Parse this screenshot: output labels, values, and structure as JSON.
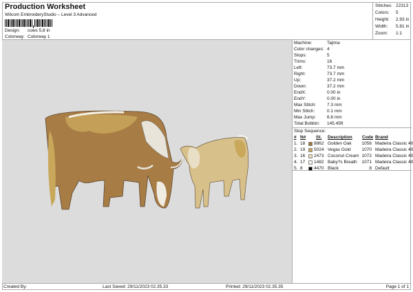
{
  "header": {
    "title": "Production Worksheet",
    "subtitle": "Wilcom EmbroideryStudio – Level 3 Advanced",
    "design_label": "Design:",
    "design_value": "cows 5,8 in",
    "colorway_label": "Colorway:",
    "colorway_value": "Colorway 1"
  },
  "stats": [
    {
      "label": "Stitches:",
      "value": "22313"
    },
    {
      "label": "Colors:",
      "value": "5"
    },
    {
      "label": "Height:",
      "value": "2.93 in"
    },
    {
      "label": "Width:",
      "value": "5.81 in"
    },
    {
      "label": "Zoom:",
      "value": "1:1"
    }
  ],
  "details": [
    {
      "label": "Machine:",
      "value": "Tajima"
    },
    {
      "label": "Color changes:",
      "value": "4"
    },
    {
      "label": "Stops:",
      "value": "5"
    },
    {
      "label": "Trims:",
      "value": "16"
    },
    {
      "label": "Left:",
      "value": "73.7 mm"
    },
    {
      "label": "Right:",
      "value": "73.7 mm"
    },
    {
      "label": "Up:",
      "value": "37.2 mm"
    },
    {
      "label": "Down:",
      "value": "37.2 mm"
    },
    {
      "label": "EndX:",
      "value": "0.00 in"
    },
    {
      "label": "EndY:",
      "value": "0.00 in"
    },
    {
      "label": "Max Stitch:",
      "value": "7.3 mm"
    },
    {
      "label": "Min Stitch:",
      "value": "0.1 mm"
    },
    {
      "label": "Max Jump:",
      "value": "6.8 mm"
    },
    {
      "label": "Total Bobbin:",
      "value": "145.45ft"
    }
  ],
  "stop_sequence": {
    "title": "Stop Sequence:",
    "headers": {
      "num": "#",
      "n": "N#",
      "st": "St.",
      "desc": "Description",
      "code": "Code",
      "brand": "Brand"
    },
    "rows": [
      {
        "num": "1.",
        "n": "18",
        "color": "#a0733c",
        "st": "8862",
        "desc": "Golden Oak",
        "code": "1056",
        "brand": "Madeira Classic 40"
      },
      {
        "num": "2.",
        "n": "19",
        "color": "#c9a85c",
        "st": "5024",
        "desc": "Vegas Gold",
        "code": "1070",
        "brand": "Madeira Classic 40"
      },
      {
        "num": "3.",
        "n": "16",
        "color": "#efdcbc",
        "st": "2473",
        "desc": "Coconut Cream",
        "code": "1072",
        "brand": "Madeira Classic 40"
      },
      {
        "num": "4.",
        "n": "17",
        "color": "#f8f6ee",
        "st": "1482",
        "desc": "Baby?s Breath",
        "code": "1071",
        "brand": "Madeira Classic 40"
      },
      {
        "num": "5.",
        "n": "8",
        "color": "#000000",
        "st": "4470",
        "desc": "Black",
        "code": "8",
        "brand": "Default"
      }
    ]
  },
  "footer": {
    "created_by": "Created By:",
    "last_saved": "Last Saved: 29/11/2023 02.35.33",
    "printed": "Printed: 29/11/2023 02.35.35",
    "page": "Page 1 of 1"
  }
}
